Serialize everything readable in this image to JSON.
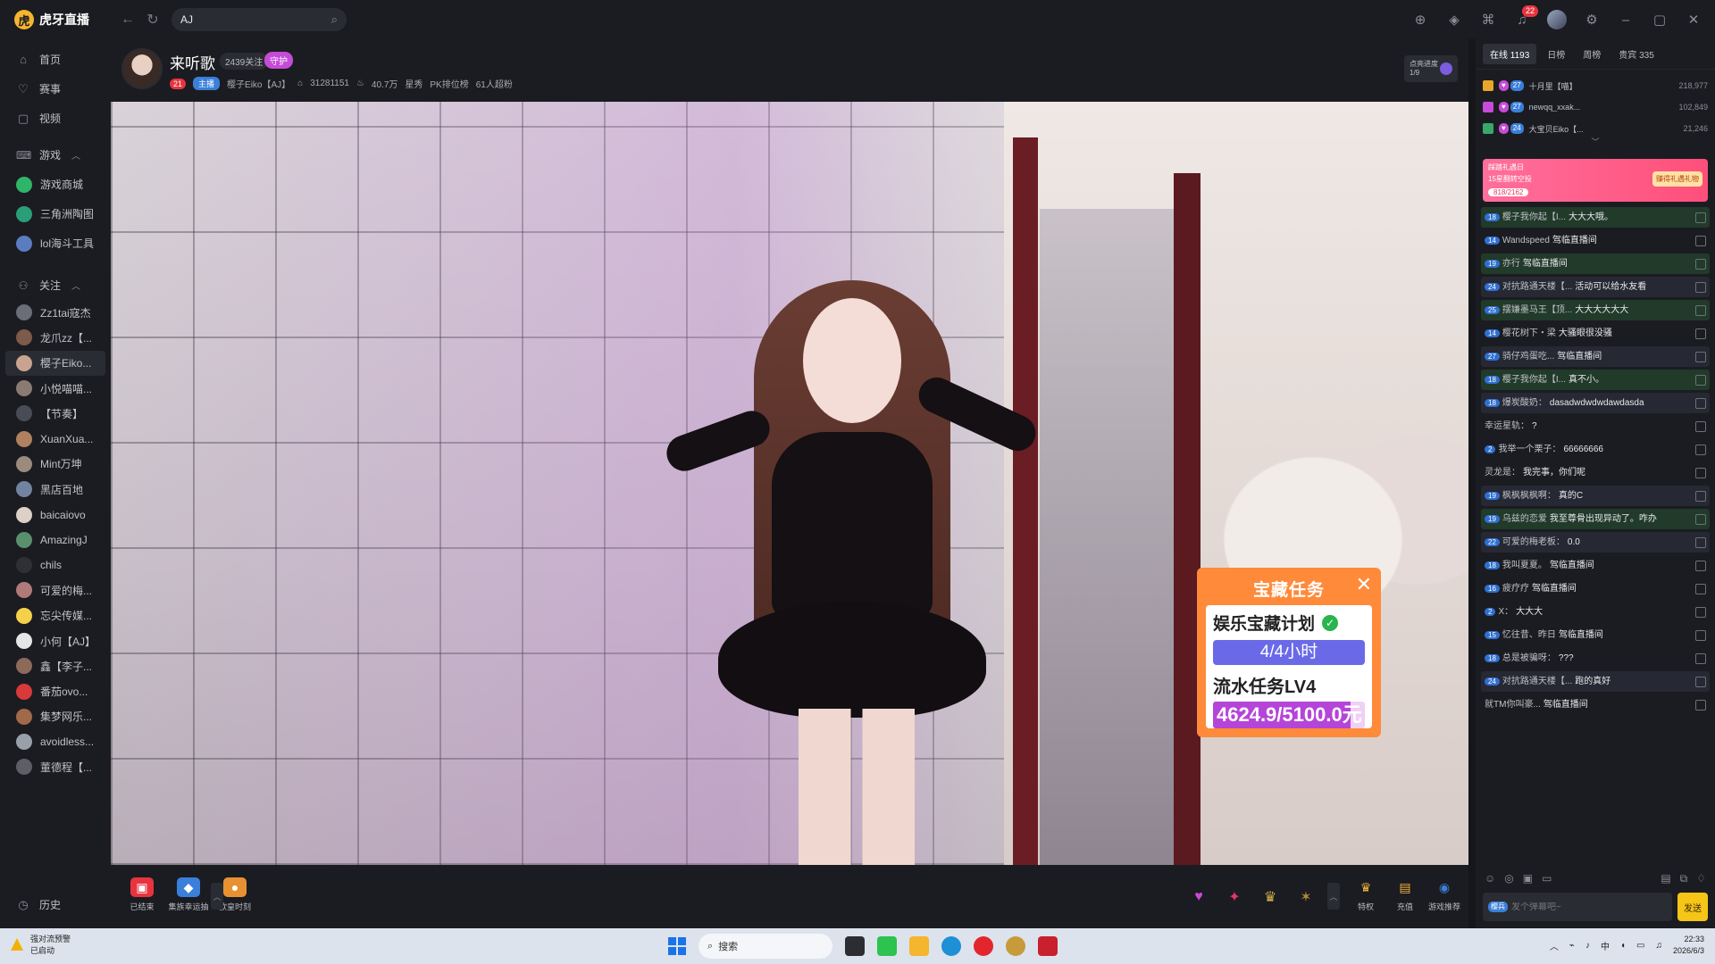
{
  "app": {
    "logo_mark": "虎",
    "name": "虎牙直播",
    "search_value": "AJ",
    "notif_count": "22"
  },
  "sidebar": {
    "top_items": [
      {
        "icon": "home-icon",
        "glyph": "⌂",
        "label": "首页"
      },
      {
        "icon": "trophy-icon",
        "glyph": "♡",
        "label": "赛事"
      },
      {
        "icon": "video-icon",
        "glyph": "▢",
        "label": "视频"
      }
    ],
    "game_section": "游戏",
    "game_items": [
      {
        "color": "#2fb56a",
        "label": "游戏商城"
      },
      {
        "color": "#2a9f77",
        "label": "三角洲陶图"
      },
      {
        "color": "#5b7cbf",
        "label": "lol海斗工具"
      }
    ],
    "follow_section": "关注",
    "follow_items": [
      {
        "color": "#6b6e78",
        "label": "Zz1tai寇杰"
      },
      {
        "color": "#7d5a4a",
        "label": "龙爪zz【..."
      },
      {
        "color": "#c9a38f",
        "label": "樱子Eiko..."
      },
      {
        "color": "#8a7b72",
        "label": "小悦喵喵..."
      },
      {
        "color": "#4a4c55",
        "label": "【节奏】"
      },
      {
        "color": "#b08060",
        "label": "XuanXua..."
      },
      {
        "color": "#9b8b7c",
        "label": "Mint万坤"
      },
      {
        "color": "#7283a0",
        "label": "黑店百地"
      },
      {
        "color": "#ddd0c6",
        "label": "baicaiovo"
      },
      {
        "color": "#5a8f6c",
        "label": "AmazingJ"
      },
      {
        "color": "#2f3036",
        "label": "chils"
      },
      {
        "color": "#b07a7a",
        "label": "可爱的梅..."
      },
      {
        "color": "#f5d04a",
        "label": "忘尖传媒..."
      },
      {
        "color": "#e6e6e6",
        "label": "小何【AJ】"
      },
      {
        "color": "#8c6a5a",
        "label": "鑫【李子..."
      },
      {
        "color": "#d83a3a",
        "label": "番茄ovo..."
      },
      {
        "color": "#a06a4a",
        "label": "集梦网乐..."
      },
      {
        "color": "#9aa0aa",
        "label": "avoidless..."
      },
      {
        "color": "#5e5f66",
        "label": "董德程【..."
      }
    ],
    "active_follow_index": 2,
    "history": "历史"
  },
  "streamer": {
    "name": "来听歌",
    "follow_count": "2439关注",
    "badge": "守护",
    "level_tag": "21",
    "fan_tag": "主播",
    "room_label": "樱子Eiko【AJ】",
    "room_id": "31281151",
    "heat": "40.7万",
    "chip_1": "星秀",
    "chip_2": "PK排位榜",
    "chip_3": "61人超粉",
    "progress_label": "点亮进度",
    "progress_value": "1/9"
  },
  "task_overlay": {
    "title": "宝藏任务",
    "row1": "娱乐宝藏计划",
    "bar1": "4/4小时",
    "row2": "流水任务LV4",
    "bar2": "4624.9/5100.0元",
    "bar2_fraction": 0.907
  },
  "toolbar": {
    "left_items": [
      {
        "label": "已结束",
        "color": "#e8343e",
        "glyph": "▣"
      },
      {
        "label": "集族幸运抽",
        "color": "#3a7fd9",
        "glyph": "◆"
      },
      {
        "label": "欧皇时刻",
        "color": "#e89132",
        "glyph": "●"
      }
    ],
    "gifts": [
      {
        "color": "#c64bd8",
        "glyph": "♥"
      },
      {
        "color": "#e8346a",
        "glyph": "✦"
      },
      {
        "color": "#d6b24a",
        "glyph": "♛"
      },
      {
        "color": "#b08a3a",
        "glyph": "✶"
      }
    ],
    "right_items": [
      {
        "label": "特权",
        "color": "#f2b33c",
        "glyph": "♛"
      },
      {
        "label": "充值",
        "color": "#f2b33c",
        "glyph": "▤"
      },
      {
        "label": "游戏推荐",
        "color": "#3a7fd9",
        "glyph": "◉"
      }
    ]
  },
  "chat": {
    "tabs": [
      "在线 1193",
      "日榜",
      "周榜",
      "贵宾 335"
    ],
    "ranks": [
      {
        "color": "#e8a72a",
        "level": "27",
        "name": "十月里【喵】",
        "score": "218,977"
      },
      {
        "color": "#c64bd8",
        "level": "27",
        "name": "newqq_xxak...",
        "score": "102,849"
      },
      {
        "color": "#3aa86a",
        "level": "24",
        "name": "大宝贝Eiko【...",
        "score": "21,246"
      }
    ],
    "banner": {
      "title": "踩踏礼遇日",
      "sub": "15星翻转空投",
      "progress": "818/2162",
      "cta": "赚得礼遇礼物"
    },
    "messages": [
      {
        "hl": "hl",
        "level": "18",
        "nick": "樱子我你起【I...",
        "text": "大大大哦。"
      },
      {
        "hl": "",
        "level": "14",
        "nick": "Wandspeed",
        "text": "驾临直播间"
      },
      {
        "hl": "hl",
        "level": "19",
        "nick": "亦行",
        "text": "驾临直播间"
      },
      {
        "hl": "hl2",
        "level": "24",
        "nick": "对抗路通天楼【...",
        "text": "活动可以给水友看"
      },
      {
        "hl": "hl",
        "level": "25",
        "nick": "摆嫌墨马王【顶...",
        "text": "大大大大大大"
      },
      {
        "hl": "",
        "level": "14",
        "nick": "樱花树下・梁",
        "text": "大骚眼很没骚"
      },
      {
        "hl": "hl2",
        "level": "27",
        "nick": "骑仔鸡蛋吃...",
        "text": "驾临直播间"
      },
      {
        "hl": "hl",
        "level": "18",
        "nick": "樱子我你起【I...",
        "text": "真不小。"
      },
      {
        "hl": "hl2",
        "level": "18",
        "nick": "爆炭酸奶：",
        "text": "dasadwdwdwdawdasda"
      },
      {
        "hl": "",
        "level": "",
        "nick": "幸运星轨：",
        "text": "?"
      },
      {
        "hl": "",
        "level": "2",
        "nick": "我举一个栗子：",
        "text": "66666666"
      },
      {
        "hl": "",
        "level": "",
        "nick": "灵龙是：",
        "text": "我完事，你们呢"
      },
      {
        "hl": "hl2",
        "level": "19",
        "nick": "枫枫枫枫啊：",
        "text": "真的C"
      },
      {
        "hl": "hl",
        "level": "19",
        "nick": "乌兹的恋爱",
        "text": "我至尊骨出现异动了。咋办"
      },
      {
        "hl": "hl2",
        "level": "22",
        "nick": "可爱的梅老板：",
        "text": "0.0"
      },
      {
        "hl": "",
        "level": "18",
        "nick": "我叫夏夏。",
        "text": "驾临直播间"
      },
      {
        "hl": "",
        "level": "16",
        "nick": "疲疗疗",
        "text": "驾临直播间"
      },
      {
        "hl": "",
        "level": "2",
        "nick": "X：",
        "text": "大大大"
      },
      {
        "hl": "",
        "level": "15",
        "nick": "忆往昔、昨日",
        "text": "驾临直播间"
      },
      {
        "hl": "",
        "level": "18",
        "nick": "总是被骗呀：",
        "text": "???"
      },
      {
        "hl": "hl2",
        "level": "24",
        "nick": "对抗路通天楼【...",
        "text": "跑的真好"
      },
      {
        "hl": "",
        "level": "",
        "nick": "就TM你叫豪...",
        "text": "驾临直播间"
      }
    ],
    "input_placeholder": "发个弹幕吧~",
    "input_tag": "樱兵",
    "send_label": "发送"
  },
  "taskbar": {
    "weather_title": "强对流预警",
    "weather_sub": "已启动",
    "search": "搜索",
    "lang": "中",
    "time": "22:33",
    "date": "2026/6/3"
  }
}
